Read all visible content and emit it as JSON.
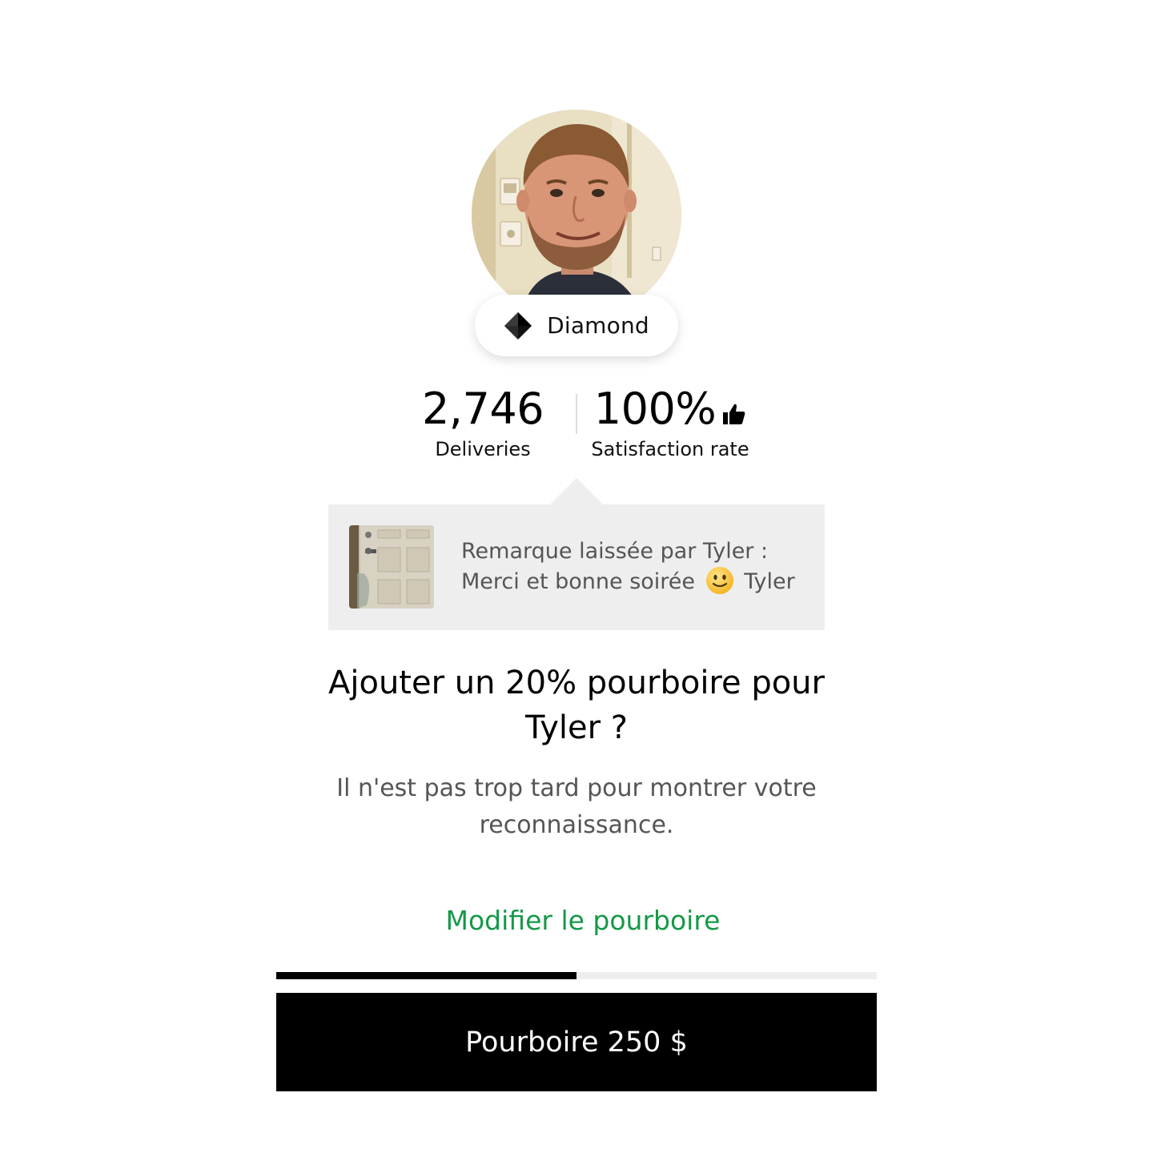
{
  "driver": {
    "tier": "Diamond",
    "tier_icon": "diamond-icon",
    "avatar_icon": "avatar-photo"
  },
  "stats": {
    "deliveries_value": "2,746",
    "deliveries_label": "Deliveries",
    "satisfaction_value": "100%",
    "satisfaction_label": "Satisfaction rate",
    "satisfaction_icon": "thumbs-up-icon"
  },
  "note": {
    "line1": "Remarque laissée par Tyler :",
    "line2_before": "Merci et bonne soirée",
    "emoji_icon": "slightly-smiling-face-icon",
    "line2_after": "Tyler"
  },
  "prompt": {
    "headline": "Ajouter un 20% pourboire pour Tyler ?",
    "subtext": "Il n'est pas trop tard pour montrer votre reconnaissance."
  },
  "actions": {
    "modify_link": "Modifier le pourboire",
    "tip_button": "Pourboire 250 $"
  },
  "progress": {
    "fraction": 0.5
  },
  "colors": {
    "accent_green": "#159947",
    "button_bg": "#000000",
    "card_bg": "#eeeeee"
  }
}
